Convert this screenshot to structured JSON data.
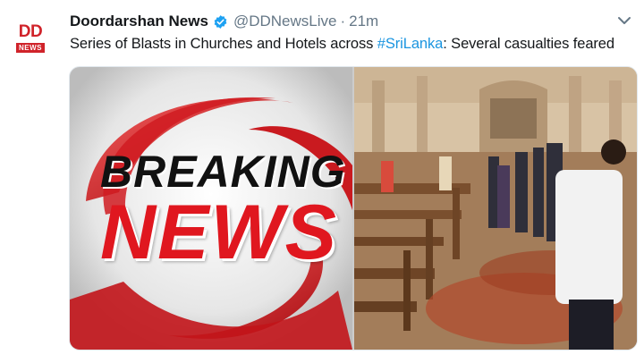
{
  "tweet": {
    "avatar": {
      "top": "DD",
      "bottom": "NEWS"
    },
    "display_name": "Doordarshan News",
    "handle": "@DDNewsLive",
    "separator": "·",
    "time": "21m",
    "text_before": "Series of Blasts in Churches and Hotels across ",
    "hashtag": "#SriLanka",
    "text_after": ": Several casualties feared",
    "media_left": {
      "line1": "BREAKING",
      "line2": "NEWS"
    }
  },
  "colors": {
    "brand_red": "#d0232a",
    "link": "#1b95e0",
    "muted": "#657786",
    "verified": "#1da1f2"
  },
  "icons": [
    "verified-badge-icon",
    "caret-down-icon"
  ]
}
